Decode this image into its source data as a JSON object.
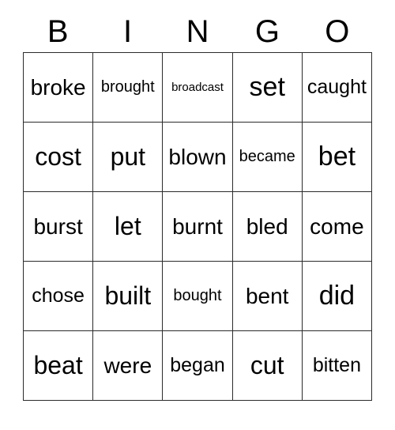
{
  "card": {
    "title_letters": [
      "B",
      "I",
      "N",
      "G",
      "O"
    ],
    "colors": {
      "text": "#000000",
      "border": "#2b2b2b",
      "background": "#ffffff"
    },
    "rows": [
      [
        {
          "word": "broke",
          "size": "fs-md"
        },
        {
          "word": "brought",
          "size": "fs-xs"
        },
        {
          "word": "broadcast",
          "size": "fs-xxs"
        },
        {
          "word": "set",
          "size": "fs-xl"
        },
        {
          "word": "caught",
          "size": "fs-sm"
        }
      ],
      [
        {
          "word": "cost",
          "size": "fs-lg"
        },
        {
          "word": "put",
          "size": "fs-lg"
        },
        {
          "word": "blown",
          "size": "fs-md"
        },
        {
          "word": "became",
          "size": "fs-xs"
        },
        {
          "word": "bet",
          "size": "fs-xl"
        }
      ],
      [
        {
          "word": "burst",
          "size": "fs-md"
        },
        {
          "word": "let",
          "size": "fs-lg"
        },
        {
          "word": "burnt",
          "size": "fs-md"
        },
        {
          "word": "bled",
          "size": "fs-md"
        },
        {
          "word": "come",
          "size": "fs-md"
        }
      ],
      [
        {
          "word": "chose",
          "size": "fs-sm"
        },
        {
          "word": "built",
          "size": "fs-lg"
        },
        {
          "word": "bought",
          "size": "fs-xs"
        },
        {
          "word": "bent",
          "size": "fs-md"
        },
        {
          "word": "did",
          "size": "fs-xl"
        }
      ],
      [
        {
          "word": "beat",
          "size": "fs-lg"
        },
        {
          "word": "were",
          "size": "fs-md"
        },
        {
          "word": "began",
          "size": "fs-sm"
        },
        {
          "word": "cut",
          "size": "fs-lg"
        },
        {
          "word": "bitten",
          "size": "fs-sm"
        }
      ]
    ]
  }
}
